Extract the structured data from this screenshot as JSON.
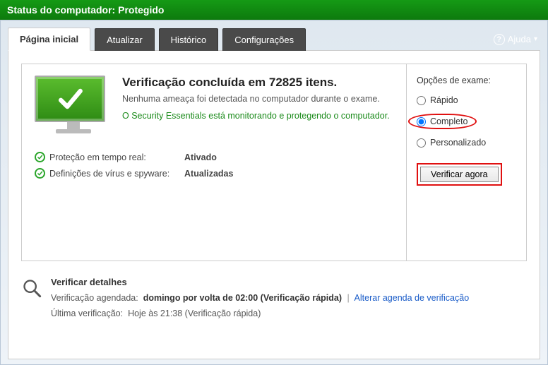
{
  "status_bar": "Status do computador: Protegido",
  "tabs": {
    "home": "Página inicial",
    "update": "Atualizar",
    "history": "Histórico",
    "settings": "Configurações"
  },
  "help": {
    "label": "Ajuda"
  },
  "main": {
    "headline": "Verificação concluída em 72825 itens.",
    "subline": "Nenhuma ameaça foi detectada no computador durante o exame.",
    "monitoring": "O Security Essentials está monitorando e protegendo o computador.",
    "statuses": [
      {
        "label": "Proteção em tempo real:",
        "value": "Ativado"
      },
      {
        "label": "Definições de vírus e spyware:",
        "value": "Atualizadas"
      }
    ]
  },
  "scan": {
    "title": "Opções de exame:",
    "options": {
      "quick": "Rápido",
      "full": "Completo",
      "custom": "Personalizado"
    },
    "selected": "full",
    "button": "Verificar agora"
  },
  "details": {
    "title": "Verificar detalhes",
    "scheduled_label": "Verificação agendada:",
    "scheduled_value": "domingo por volta de 02:00 (Verificação rápida)",
    "change_schedule_link": "Alterar agenda de verificação",
    "last_scan_label": "Última verificação:",
    "last_scan_value": "Hoje às 21:38 (Verificação rápida)"
  }
}
